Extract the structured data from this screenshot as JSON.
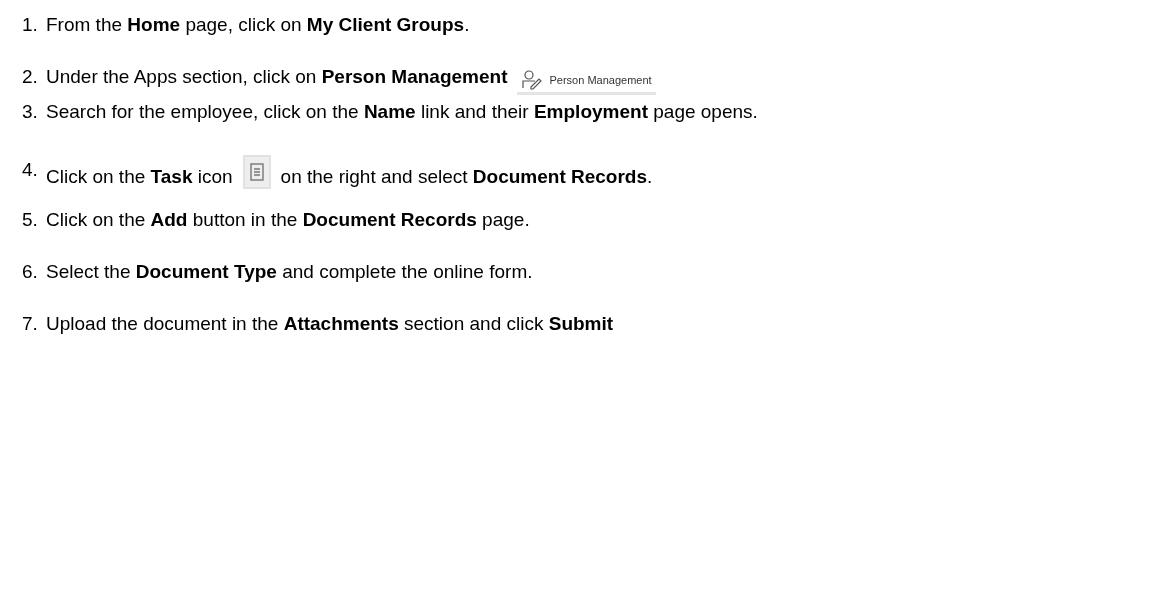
{
  "steps": [
    {
      "number": "1.",
      "kind": "plain",
      "text": "From the **Home** page, click on **My Client Groups**."
    },
    {
      "number": "2.",
      "kind": "app_button",
      "text": "Under the Apps section, click on **Person Management**",
      "button_label": "Person Management"
    },
    {
      "number": "3.",
      "kind": "plain",
      "text": "Search for the employee, click on the **Name** link and their **Employment** page opens."
    },
    {
      "number": "4.",
      "kind": "task_icon",
      "text": "Click on the **Task** icon",
      "text_after": "on the right and select **Document Records**."
    },
    {
      "number": "5.",
      "kind": "plain",
      "text": "Click on the **Add** button in the **Document Records** page."
    },
    {
      "number": "6.",
      "kind": "plain",
      "text": "Select the **Document Type** and complete the online form."
    },
    {
      "number": "7.",
      "kind": "plain",
      "text": "Upload the document in the **Attachments** section and click **Submit**"
    }
  ]
}
